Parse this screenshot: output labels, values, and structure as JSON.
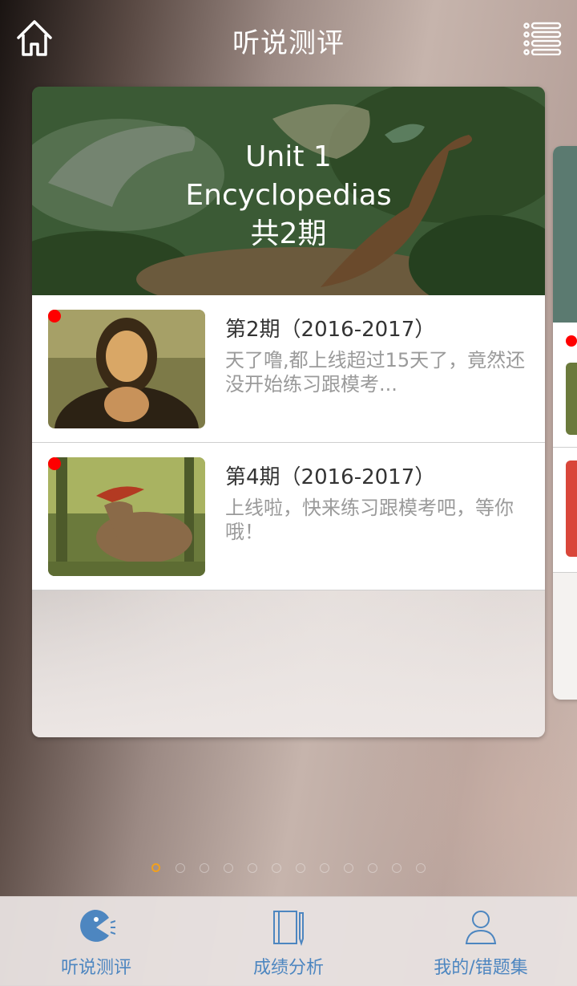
{
  "header": {
    "title": "听说测评",
    "home_icon": "home-icon",
    "menu_icon": "list-menu-icon"
  },
  "unit_card": {
    "unit": "Unit 1",
    "topic": "Encyclopedias",
    "count": "共2期",
    "items": [
      {
        "title": "第2期（2016-2017）",
        "desc": "天了噜,都上线超过15天了，竟然还没开始练习跟模考...",
        "is_new": true,
        "thumb": "mona-lisa-image"
      },
      {
        "title": "第4期（2016-2017）",
        "desc": "上线啦，快来练习跟模考吧，等你哦！",
        "is_new": true,
        "thumb": "dinosaur-image"
      }
    ]
  },
  "pager": {
    "count": 12,
    "active_index": 0
  },
  "tabs": [
    {
      "label": "听说测评",
      "icon": "speak-icon",
      "active": true
    },
    {
      "label": "成绩分析",
      "icon": "notebook-icon",
      "active": false
    },
    {
      "label": "我的/错题集",
      "icon": "user-icon",
      "active": false
    }
  ],
  "colors": {
    "accent": "#4d86c0",
    "badge": "#ff0000",
    "pager_active": "#f2a01c"
  }
}
